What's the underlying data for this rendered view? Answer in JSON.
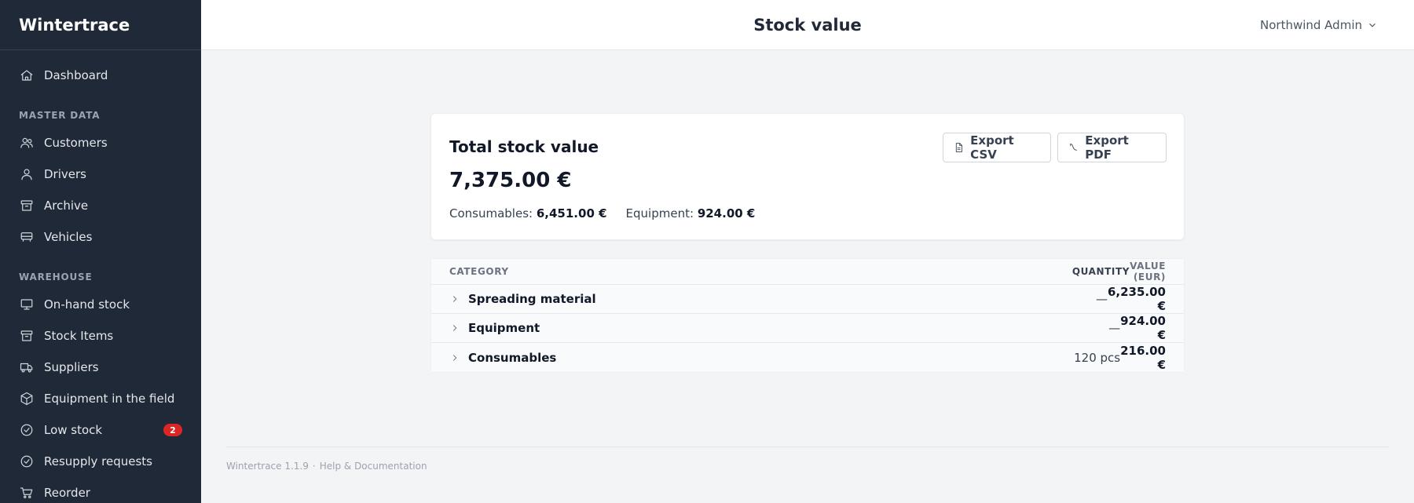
{
  "app": {
    "name": "Wintertrace"
  },
  "header": {
    "title": "Stock value",
    "user": "Northwind Admin"
  },
  "sidebar": {
    "items_top": [
      {
        "label": "Dashboard",
        "icon": "home-icon"
      }
    ],
    "master_data": {
      "title": "MASTER DATA",
      "items": [
        {
          "label": "Customers",
          "icon": "users-icon"
        },
        {
          "label": "Drivers",
          "icon": "user-icon"
        },
        {
          "label": "Archive",
          "icon": "archive-icon"
        },
        {
          "label": "Vehicles",
          "icon": "vehicle-icon"
        }
      ]
    },
    "warehouse": {
      "title": "WAREHOUSE",
      "items": [
        {
          "label": "On-hand stock",
          "icon": "monitor-icon"
        },
        {
          "label": "Stock Items",
          "icon": "archive-icon"
        },
        {
          "label": "Suppliers",
          "icon": "truck-icon"
        },
        {
          "label": "Equipment in the field",
          "icon": "box-icon"
        },
        {
          "label": "Low stock",
          "icon": "check-circle-icon",
          "badge": "2"
        },
        {
          "label": "Resupply requests",
          "icon": "check-circle-icon"
        },
        {
          "label": "Reorder",
          "icon": "cart-icon"
        }
      ]
    }
  },
  "summary": {
    "title": "Total stock value",
    "total": "7,375.00 €",
    "consumables_label": "Consumables:",
    "consumables_value": "6,451.00 €",
    "equipment_label": "Equipment:",
    "equipment_value": "924.00 €",
    "export_csv": "Export CSV",
    "export_pdf": "Export PDF"
  },
  "table": {
    "columns": {
      "category": "CATEGORY",
      "quantity": "QUANTITY",
      "value": "VALUE (EUR)"
    },
    "rows": [
      {
        "category": "Spreading material",
        "quantity": "—",
        "value": "6,235.00 €"
      },
      {
        "category": "Equipment",
        "quantity": "—",
        "value": "924.00 €"
      },
      {
        "category": "Consumables",
        "quantity": "120 pcs",
        "value": "216.00 €"
      }
    ]
  },
  "footer": {
    "version": "Wintertrace 1.1.9",
    "separator": "·",
    "help": "Help & Documentation"
  },
  "colors": {
    "sidebar": "#1f2937",
    "badge": "#dc2626",
    "background": "#f3f4f6"
  }
}
